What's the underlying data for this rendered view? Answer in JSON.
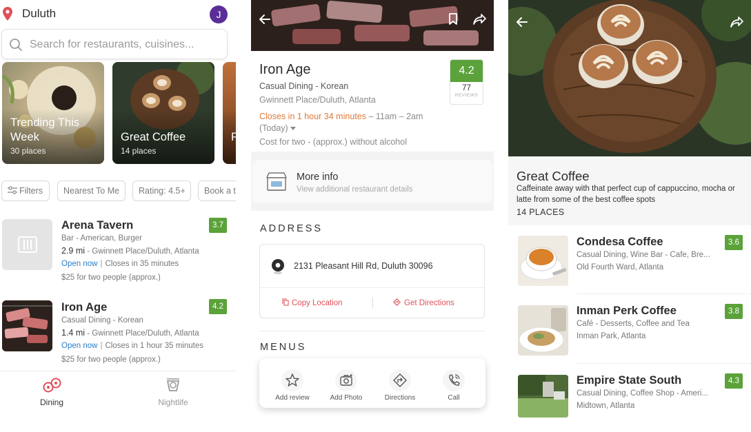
{
  "search_screen": {
    "location": "Duluth",
    "avatar_initial": "J",
    "search_placeholder": "Search for restaurants, cuisines...",
    "collections": [
      {
        "title": "Trending This Week",
        "count": "30 places"
      },
      {
        "title": "Great Coffee",
        "count": "14 places"
      },
      {
        "title": "P",
        "count": ""
      }
    ],
    "filters": [
      {
        "label": "Filters",
        "icon": "sliders-icon"
      },
      {
        "label": "Nearest To Me"
      },
      {
        "label": "Rating: 4.5+"
      },
      {
        "label": "Book a t"
      }
    ],
    "restaurants": [
      {
        "name": "Arena Tavern",
        "cuisine": "Bar - American, Burger",
        "distance": "2.9 mi",
        "area": "- Gwinnett Place/Duluth, Atlanta",
        "status": "Open now",
        "hours": "Closes in 35 minutes",
        "price": "$25 for two people (approx.)",
        "rating": "3.7",
        "thumb_icon": "restaurant-placeholder-icon"
      },
      {
        "name": "Iron Age",
        "cuisine": "Casual Dining - Korean",
        "distance": "1.4 mi",
        "area": "- Gwinnett Place/Duluth, Atlanta",
        "status": "Open now",
        "hours": "Closes in 1 hour 35 minutes",
        "price": "$25 for two people (approx.)",
        "rating": "4.2"
      }
    ],
    "nav": [
      {
        "label": "Dining",
        "icon": "dining-icon",
        "active": true
      },
      {
        "label": "Nightlife",
        "icon": "nightlife-icon",
        "active": false
      }
    ]
  },
  "detail_screen": {
    "name": "Iron Age",
    "cuisine": "Casual Dining - Korean",
    "area": "Gwinnett Place/Duluth, Atlanta",
    "closes": "Closes in 1 hour 34 minutes",
    "hours": "– 11am – 2am",
    "today": "(Today)",
    "cost": "Cost for two - (approx.)  without alcohol",
    "rating": "4.2",
    "review_count": "77",
    "reviews_label": "REVIEWS",
    "more_info_title": "More info",
    "more_info_sub": "View additional restaurant details",
    "address_heading": "ADDRESS",
    "address": "2131 Pleasant Hill Rd, Duluth 30096",
    "copy_location": "Copy Location",
    "get_directions": "Get Directions",
    "menus_heading": "MENUS",
    "actions": [
      {
        "label": "Add review",
        "icon": "star-icon"
      },
      {
        "label": "Add Photo",
        "icon": "camera-icon"
      },
      {
        "label": "Directions",
        "icon": "directions-icon"
      },
      {
        "label": "Call",
        "icon": "phone-icon"
      }
    ],
    "colors": {
      "accent_red": "#e0505a",
      "rating_green": "#5ba23a",
      "closes_orange": "#e07a3a"
    }
  },
  "collection_screen": {
    "title": "Great Coffee",
    "description": "Caffeinate away with that perfect cup of cappuccino, mocha or latte from some of the best coffee spots",
    "count": "14 PLACES",
    "places": [
      {
        "name": "Condesa Coffee",
        "cuisine": "Casual Dining, Wine Bar - Cafe, Bre...",
        "area": "Old Fourth Ward, Atlanta",
        "rating": "3.6"
      },
      {
        "name": "Inman Perk Coffee",
        "cuisine": "Café - Desserts, Coffee and Tea",
        "area": "Inman Park, Atlanta",
        "rating": "3.8"
      },
      {
        "name": "Empire State South",
        "cuisine": "Casual Dining, Coffee Shop - Ameri...",
        "area": "Midtown, Atlanta",
        "rating": "4.3"
      }
    ]
  }
}
